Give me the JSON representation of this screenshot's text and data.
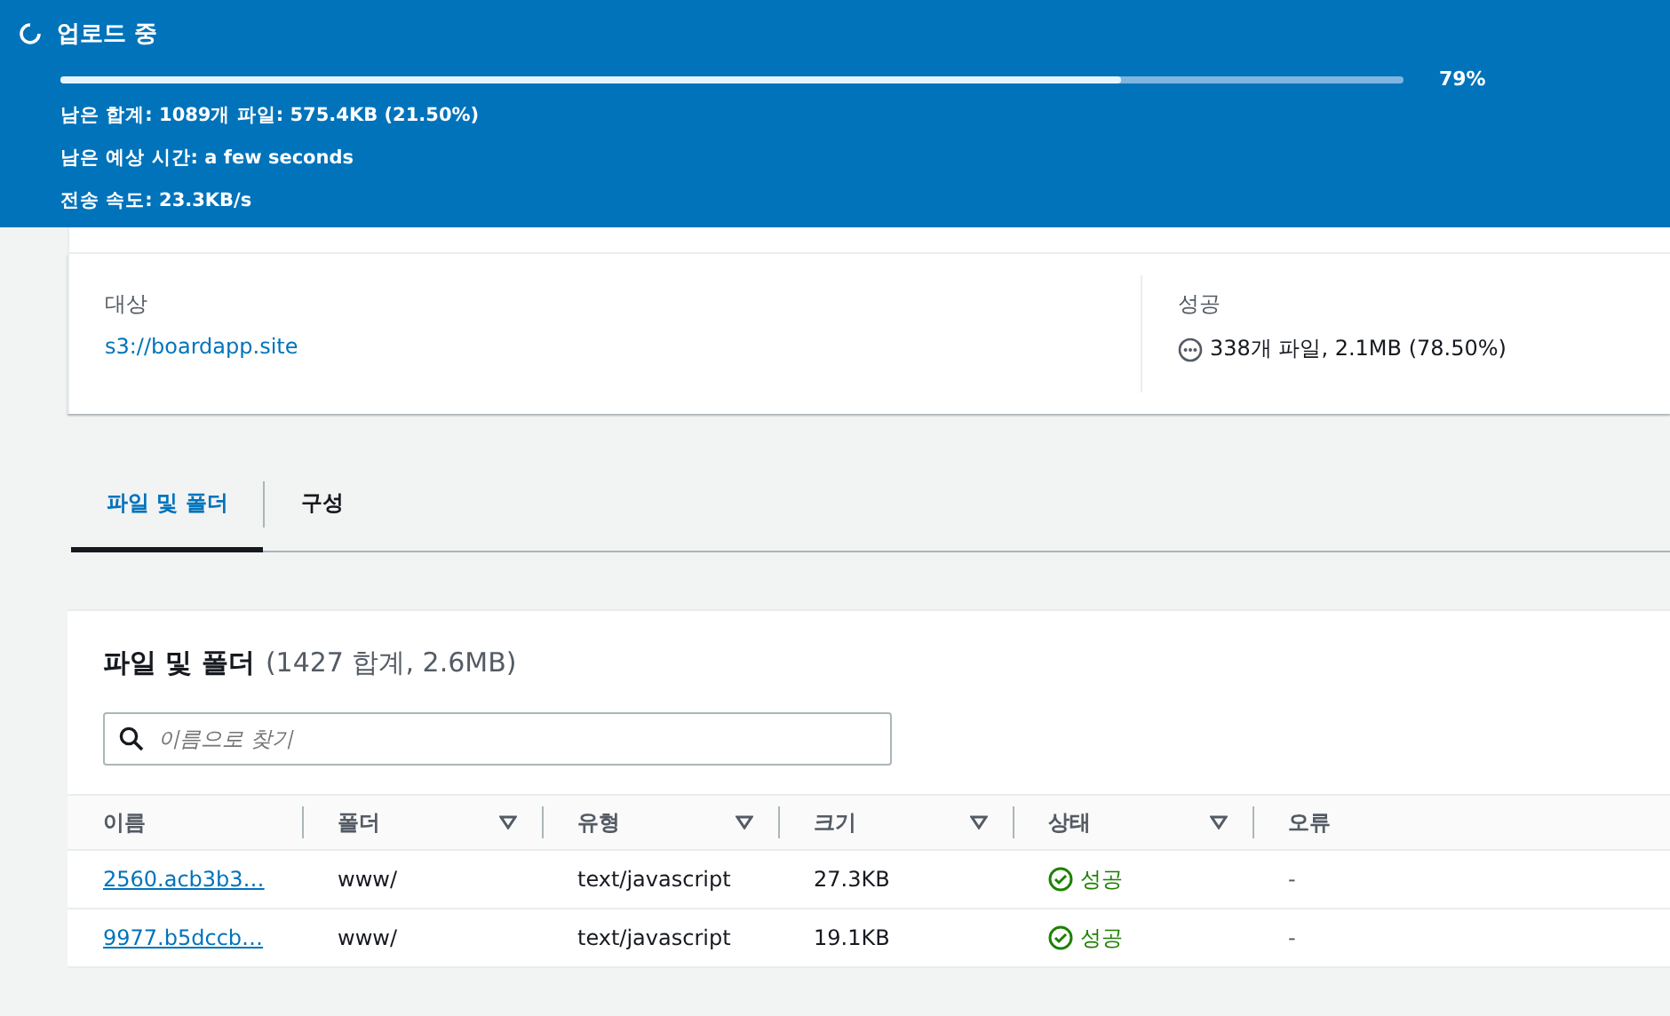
{
  "upload_banner": {
    "title": "업로드 중",
    "progress": {
      "level": 0.79,
      "reading": "79%"
    },
    "details": [
      "남은 합계: 1089개 파일: 575.4KB (21.50%)",
      "남은 예상 시간: a few seconds",
      "전송 속도: 23.3KB/s"
    ]
  },
  "summary": {
    "destination": {
      "label": "대상",
      "value": "s3://boardapp.site"
    },
    "succeeded": {
      "label": "성공",
      "value": "338개 파일, 2.1MB (78.50%)"
    }
  },
  "tabs": [
    {
      "label": "파일 및 폴더",
      "selected": true
    },
    {
      "label": "구성",
      "selected": false
    }
  ],
  "files_panel": {
    "title": "파일 및 폴더",
    "count": "(1427 합계, 2.6MB)",
    "search": {
      "placeholder": "이름으로 찾기"
    },
    "columns": [
      {
        "label": "이름",
        "sortable": false
      },
      {
        "label": "폴더",
        "sortable": true
      },
      {
        "label": "유형",
        "sortable": true
      },
      {
        "label": "크기",
        "sortable": true
      },
      {
        "label": "상태",
        "sortable": true
      },
      {
        "label": "오류",
        "sortable": false
      }
    ],
    "rows": [
      {
        "name": "2560.acb3b3…",
        "folder": "www/",
        "type": "text/javascript",
        "size": "27.3KB",
        "status": "성공",
        "kind": "success",
        "error": "-"
      },
      {
        "name": "9977.b5dccb…",
        "folder": "www/",
        "type": "text/javascript",
        "size": "19.1KB",
        "status": "성공",
        "kind": "success",
        "error": "-"
      }
    ]
  }
}
